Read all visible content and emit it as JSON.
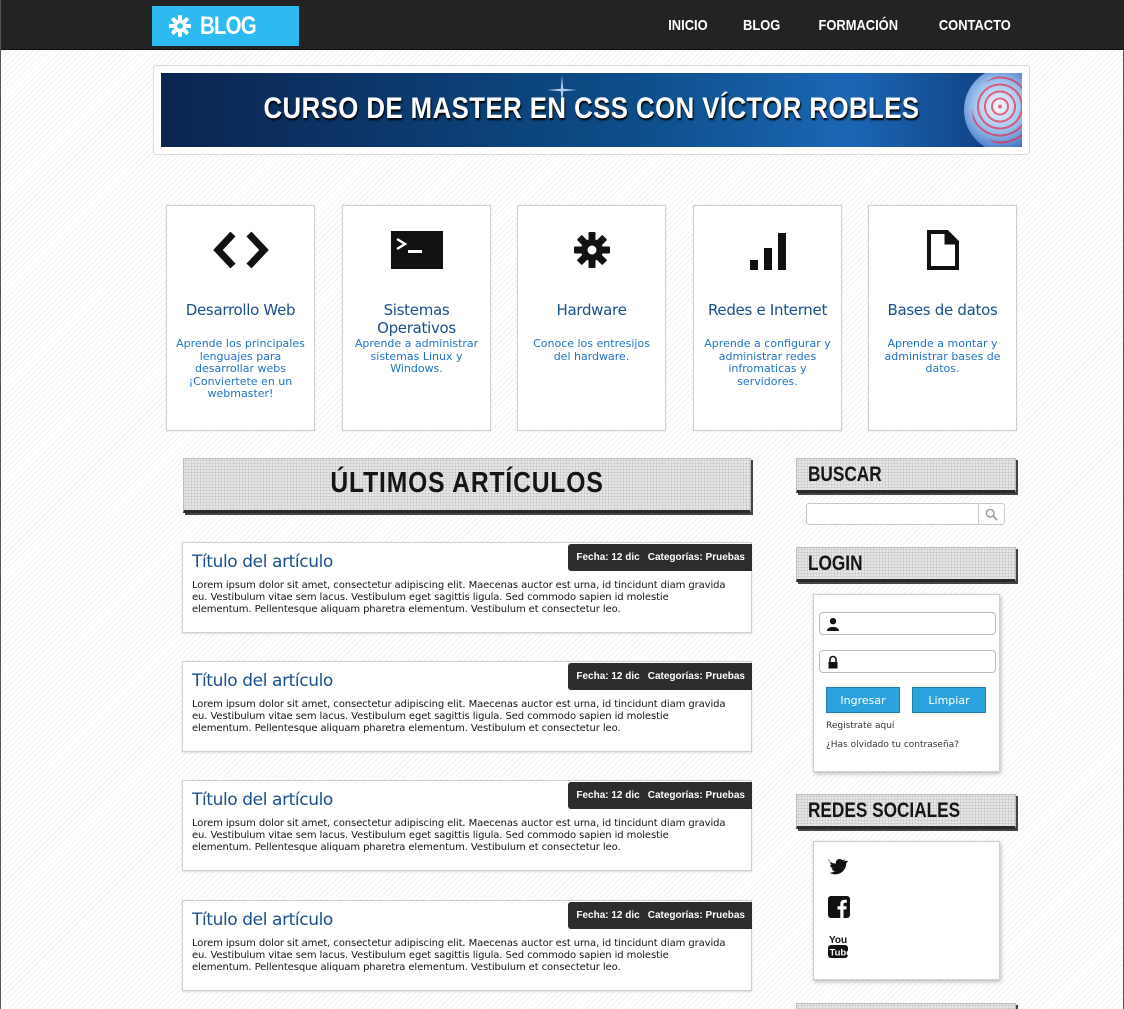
{
  "header": {
    "logo_text": "BLOG",
    "nav": [
      "INICIO",
      "BLOG",
      "FORMACIÓN",
      "CONTACTO"
    ]
  },
  "banner": {
    "title": "CURSO DE MASTER EN CSS CON VÍCTOR ROBLES"
  },
  "categories": [
    {
      "icon": "code-icon",
      "title": "Desarrollo Web",
      "desc": "Aprende los principales lenguajes para desarrollar webs ¡Conviertete en un webmaster!"
    },
    {
      "icon": "terminal-icon",
      "title": "Sistemas Operativos",
      "desc": "Aprende a administrar sistemas Linux y Windows."
    },
    {
      "icon": "gear-icon",
      "title": "Hardware",
      "desc": "Conoce los entresijos del hardware."
    },
    {
      "icon": "signal-bars-icon",
      "title": "Redes e Internet",
      "desc": "Aprende a configurar y administrar redes infromaticas y servidores."
    },
    {
      "icon": "document-icon",
      "title": "Bases de datos",
      "desc": "Aprende a montar y administrar bases de datos."
    }
  ],
  "main": {
    "heading": "ÚLTIMOS ARTÍCULOS",
    "articles": [
      {
        "title": "Título del artículo",
        "date_label": "Fecha:",
        "date": "12 dic",
        "category_label": "Categorías:",
        "category": "Pruebas",
        "body": "Lorem ipsum dolor sit amet, consectetur adipiscing elit. Maecenas auctor est urna, id tincidunt diam gravida eu. Vestibulum vitae sem lacus. Vestibulum eget sagittis ligula. Sed commodo sapien id molestie elementum. Pellentesque aliquam pharetra elementum. Vestibulum et consectetur leo."
      },
      {
        "title": "Título del artículo",
        "date_label": "Fecha:",
        "date": "12 dic",
        "category_label": "Categorías:",
        "category": "Pruebas",
        "body": "Lorem ipsum dolor sit amet, consectetur adipiscing elit. Maecenas auctor est urna, id tincidunt diam gravida eu. Vestibulum vitae sem lacus. Vestibulum eget sagittis ligula. Sed commodo sapien id molestie elementum. Pellentesque aliquam pharetra elementum. Vestibulum et consectetur leo."
      },
      {
        "title": "Título del artículo",
        "date_label": "Fecha:",
        "date": "12 dic",
        "category_label": "Categorías:",
        "category": "Pruebas",
        "body": "Lorem ipsum dolor sit amet, consectetur adipiscing elit. Maecenas auctor est urna, id tincidunt diam gravida eu. Vestibulum vitae sem lacus. Vestibulum eget sagittis ligula. Sed commodo sapien id molestie elementum. Pellentesque aliquam pharetra elementum. Vestibulum et consectetur leo."
      },
      {
        "title": "Título del artículo",
        "date_label": "Fecha:",
        "date": "12 dic",
        "category_label": "Categorías:",
        "category": "Pruebas",
        "body": "Lorem ipsum dolor sit amet, consectetur adipiscing elit. Maecenas auctor est urna, id tincidunt diam gravida eu. Vestibulum vitae sem lacus. Vestibulum eget sagittis ligula. Sed commodo sapien id molestie elementum. Pellentesque aliquam pharetra elementum. Vestibulum et consectetur leo."
      }
    ]
  },
  "sidebar": {
    "search": {
      "heading": "BUSCAR",
      "value": "",
      "placeholder": ""
    },
    "login": {
      "heading": "LOGIN",
      "user_value": "",
      "password_value": "",
      "submit_label": "Ingresar",
      "clear_label": "Limpiar",
      "register_link": "Registrate aquí",
      "forgot_link": "¿Has olvidado tu contraseña?"
    },
    "social": {
      "heading": "REDES SOCIALES",
      "items": [
        "twitter-icon",
        "facebook-icon",
        "youtube-icon"
      ]
    }
  },
  "colors": {
    "topbar": "#232323",
    "logo_bg": "#2dbaf0",
    "link_blue": "#1a4f8c",
    "button_blue": "#2ca3dc",
    "meta_bg": "#2d2d2d"
  }
}
